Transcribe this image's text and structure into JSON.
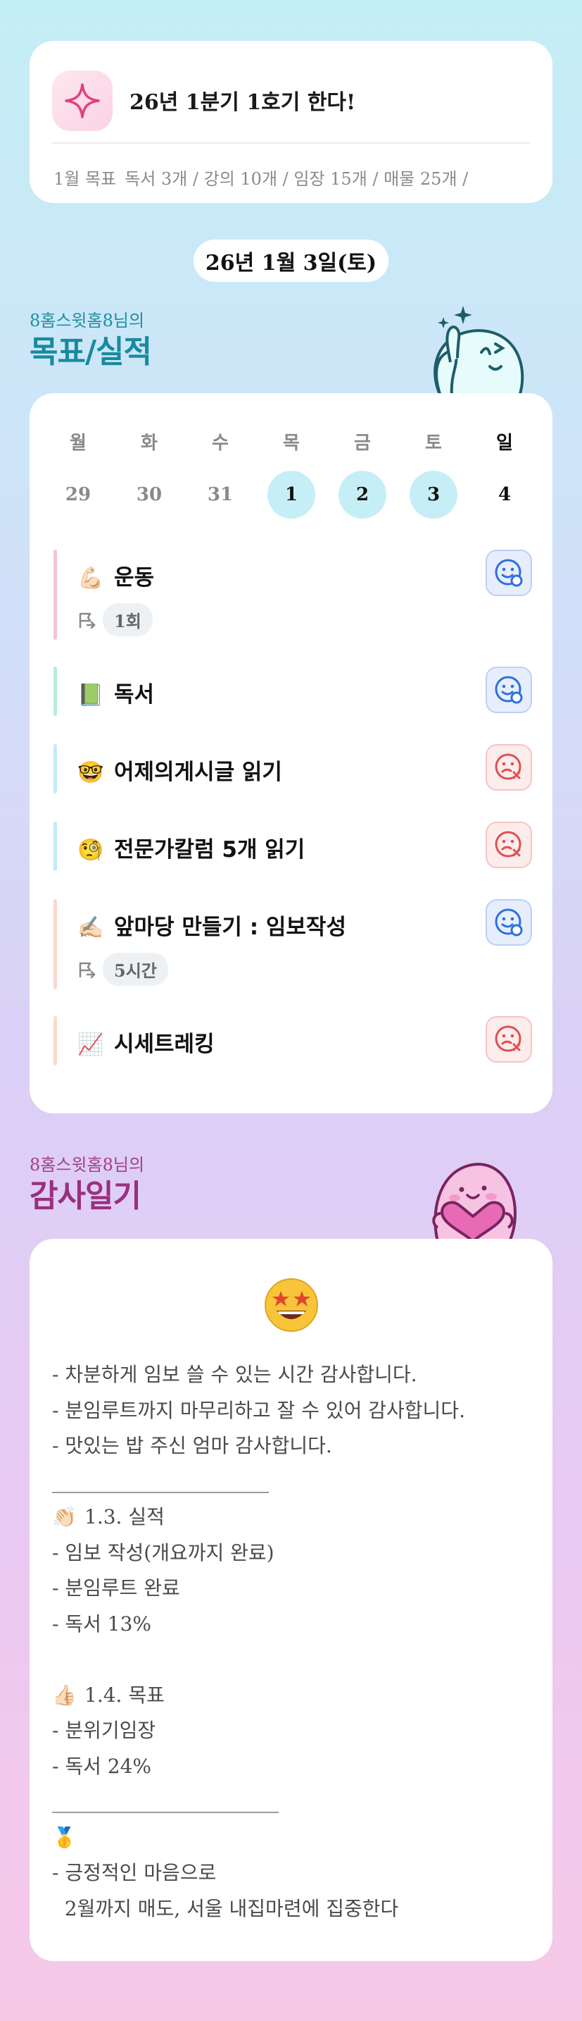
{
  "top": {
    "title": "26년 1분기 1호기 한다!",
    "goal_label": "1월 목표",
    "goal_text": "독서 3개 / 강의 10개 / 임장 15개 / 매물 25개 /"
  },
  "date": "26년 1월 3일(토)",
  "goals_section": {
    "user": "8홈스윗홈8님의",
    "title": "목표/실적",
    "weekdays": [
      "월",
      "화",
      "수",
      "목",
      "금",
      "토",
      "일"
    ],
    "days": [
      "29",
      "30",
      "31",
      "1",
      "2",
      "3",
      "4"
    ],
    "tasks": [
      {
        "emoji": "💪🏻",
        "name": "운동",
        "badge": "1회",
        "status": "ok",
        "bar_color": "#f6c3d6"
      },
      {
        "emoji": "📗",
        "name": "독서",
        "badge": "",
        "status": "ok",
        "bar_color": "#b8ecd6"
      },
      {
        "emoji": "🤓",
        "name": "어제의게시글 읽기",
        "badge": "",
        "status": "no",
        "bar_color": "#bfeef4"
      },
      {
        "emoji": "🧐",
        "name": "전문가칼럼 5개 읽기",
        "badge": "",
        "status": "no",
        "bar_color": "#bfeef4"
      },
      {
        "emoji": "✍🏻",
        "name": "앞마당 만들기 : 임보작성",
        "badge": "5시간",
        "status": "ok",
        "bar_color": "#fbd9cd"
      },
      {
        "emoji": "📈",
        "name": "시세트레킹",
        "badge": "",
        "status": "no",
        "bar_color": "#fbd9cd"
      }
    ]
  },
  "diary_section": {
    "user": "8홈스윗홈8님의",
    "title": "감사일기",
    "emoji": "🤩",
    "lines": [
      {
        "e": "",
        "t": "- 차분하게 임보 쓸 수 있는 시간 감사합니다."
      },
      {
        "e": "",
        "t": "- 분임루트까지 마무리하고 잘 수 있어 감사합니다."
      },
      {
        "e": "",
        "t": "- 맛있는 밥 주신 엄마 감사합니다."
      },
      {
        "e": "",
        "t": "______________________"
      },
      {
        "e": "👏🏻",
        "t": "1.3. 실적"
      },
      {
        "e": "",
        "t": "- 임보 작성(개요까지 완료)"
      },
      {
        "e": "",
        "t": "- 분임루트 완료"
      },
      {
        "e": "",
        "t": "- 독서 13%"
      },
      {
        "e": "",
        "t": ""
      },
      {
        "e": "👍🏻",
        "t": "1.4. 목표"
      },
      {
        "e": "",
        "t": "- 분위기임장"
      },
      {
        "e": "",
        "t": "- 독서 24%"
      },
      {
        "e": "",
        "t": "_______________________"
      },
      {
        "e": "🥇",
        "t": ""
      },
      {
        "e": "",
        "t": "- 긍정적인 마음으로"
      },
      {
        "e": "",
        "t": "  2월까지 매도, 서울 내집마련에 집중한다"
      }
    ]
  }
}
